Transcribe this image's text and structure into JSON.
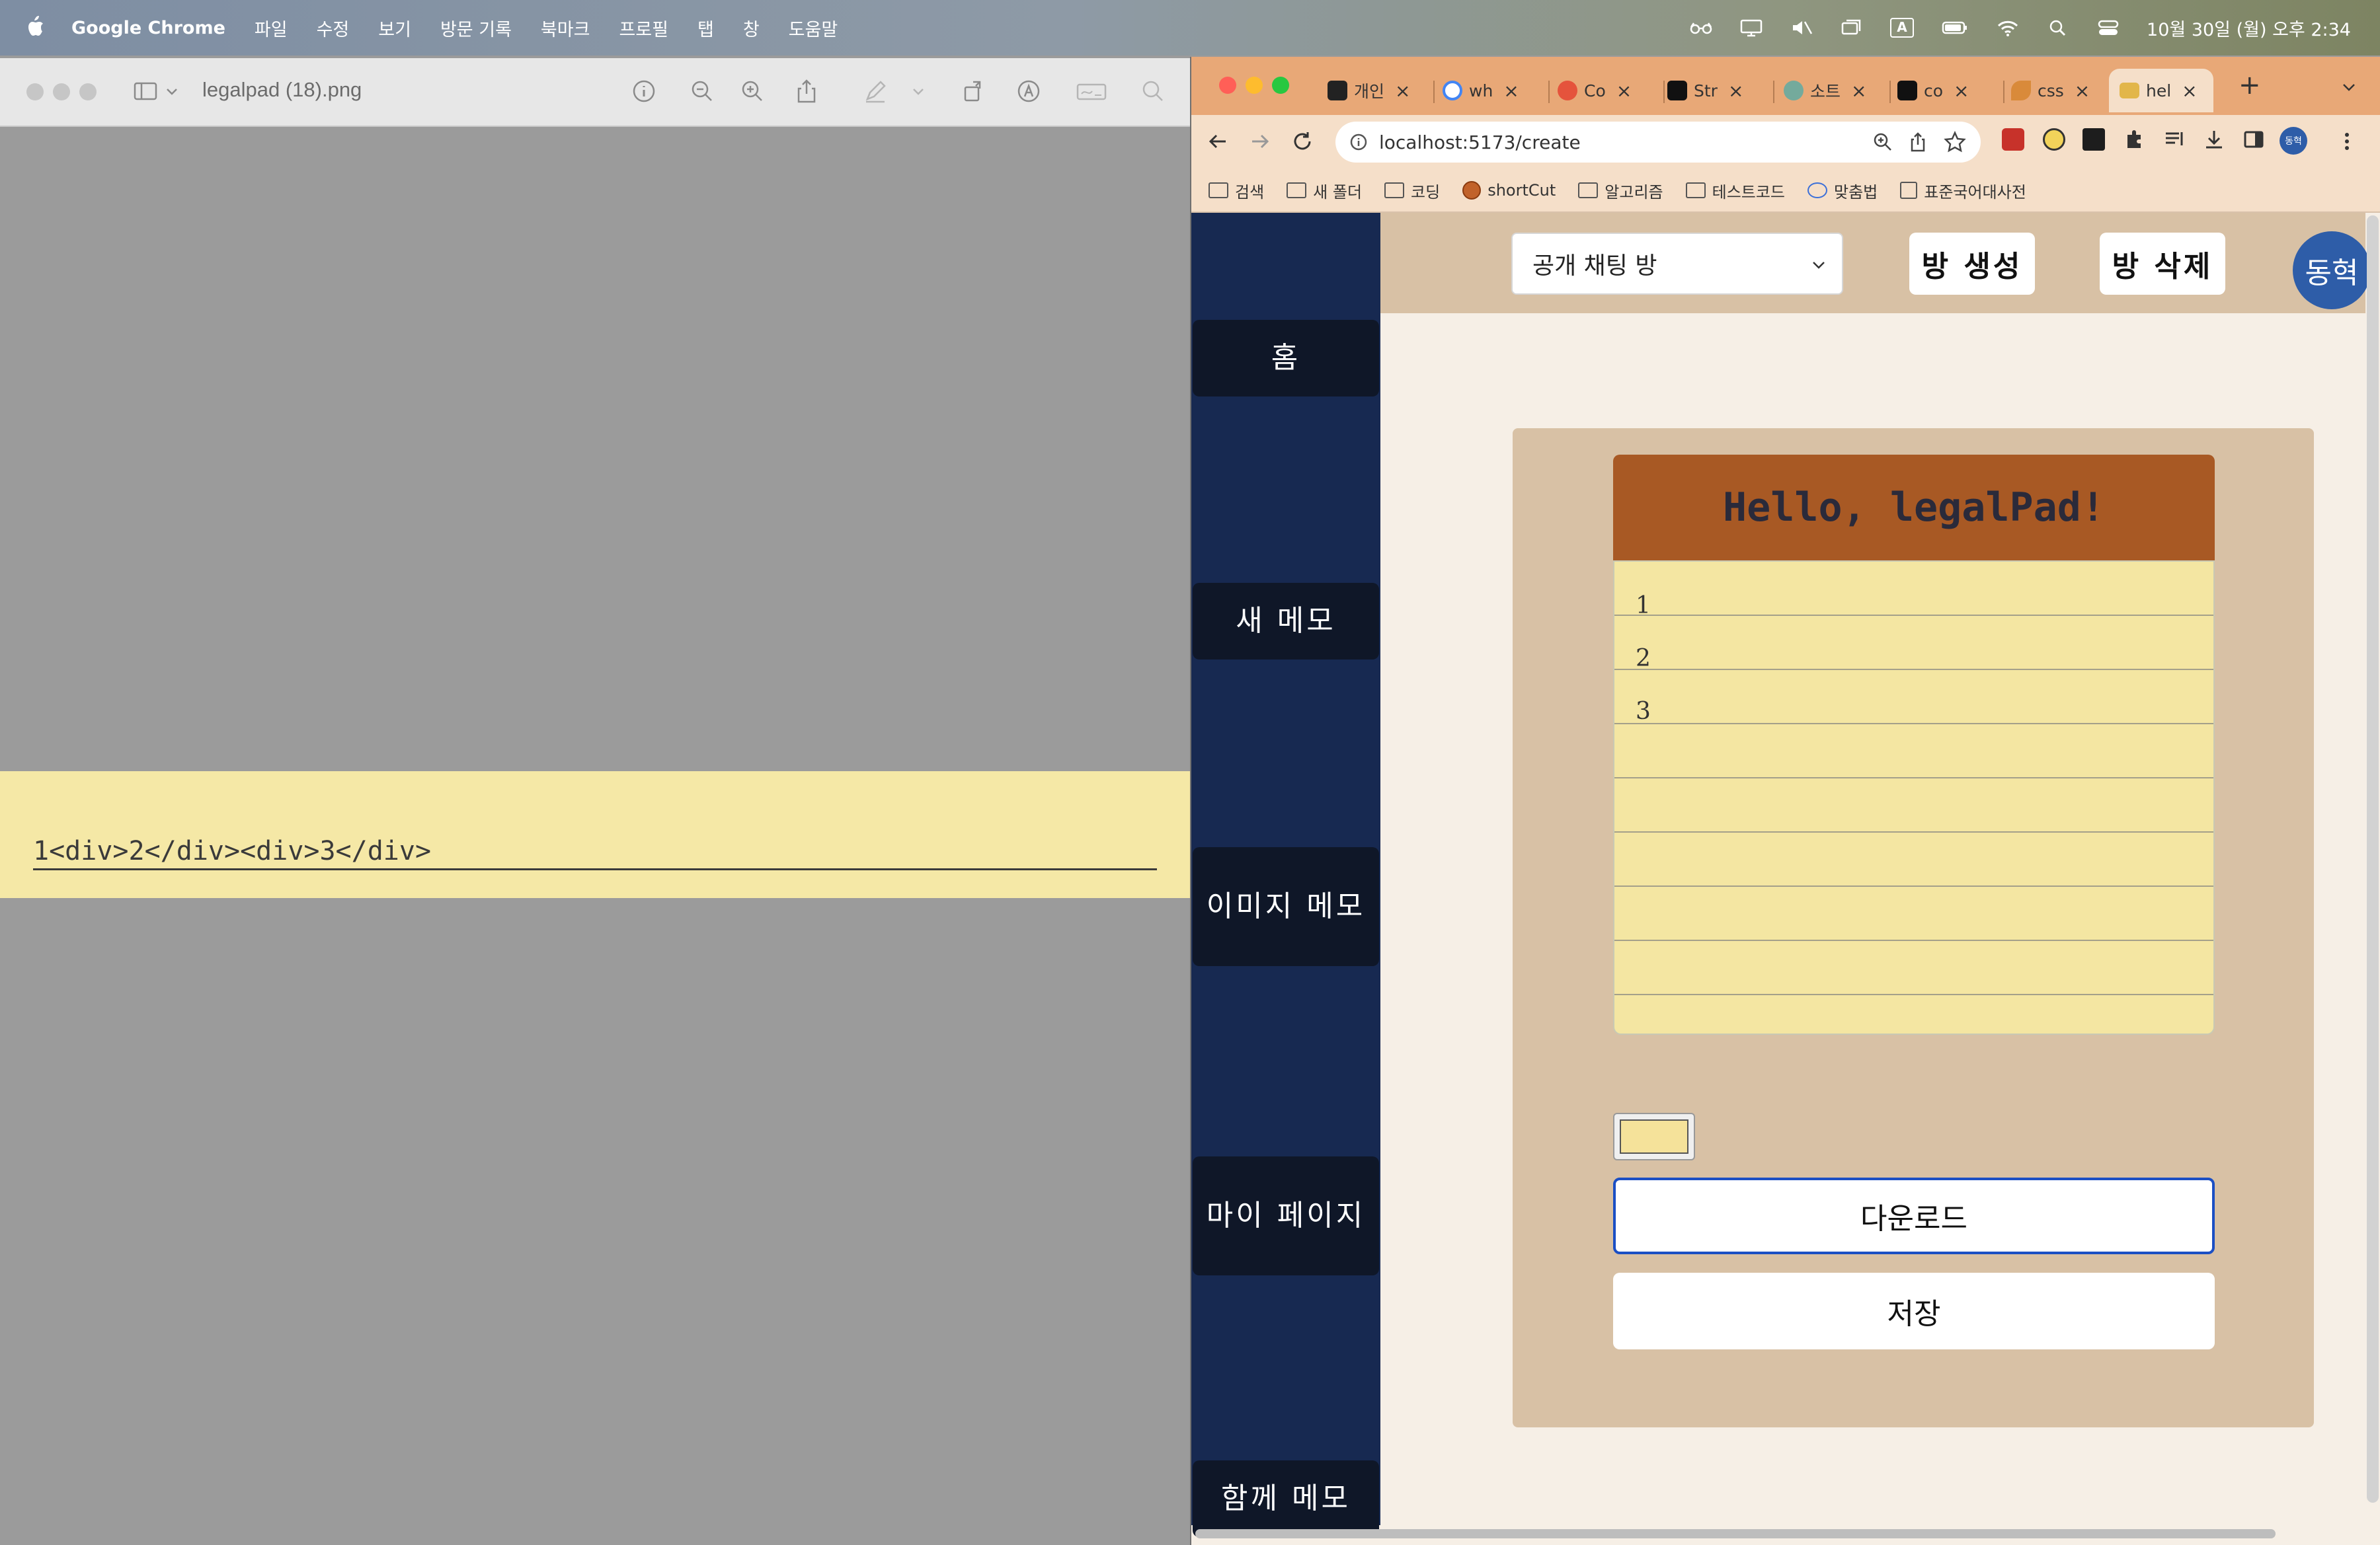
{
  "menubar": {
    "app_name": "Google Chrome",
    "items": [
      "파일",
      "수정",
      "보기",
      "방문 기록",
      "북마크",
      "프로필",
      "탭",
      "창",
      "도움말"
    ],
    "icons": [
      "glasses-icon",
      "display-icon",
      "mute-icon",
      "windows-icon",
      "input-icon",
      "battery-icon",
      "wifi-icon",
      "search-icon",
      "control-center-icon"
    ],
    "input_indicator": "A",
    "datetime": "10월 30일 (월) 오후 2:34"
  },
  "preview": {
    "file_name": "legalpad (18).png",
    "content_text": "1<div>2</div><div>3</div>"
  },
  "chrome": {
    "tabs": [
      {
        "label": "개인",
        "favicon": "notion-icon",
        "color": "#222222"
      },
      {
        "label": "wh",
        "favicon": "google-icon",
        "color": "#4285f4"
      },
      {
        "label": "Co",
        "favicon": "red-icon",
        "color": "#e5533c"
      },
      {
        "label": "Str",
        "favicon": "m-icon",
        "color": "#111111"
      },
      {
        "label": "소트",
        "favicon": "openai-icon",
        "color": "#74aa9c"
      },
      {
        "label": "co",
        "favicon": "m-icon",
        "color": "#111111"
      },
      {
        "label": "css",
        "favicon": "leaf-icon",
        "color": "#d98a3a"
      },
      {
        "label": "hel",
        "favicon": "legalpad-icon",
        "color": "#e2b64a",
        "active": true
      }
    ],
    "new_tab": "+",
    "url": "localhost:5173/create",
    "profile_badge": "동혁",
    "bookmarks": [
      "검색",
      "새 폴더",
      "코딩",
      "shortCut",
      "알고리즘",
      "테스트코드",
      "맞춤법",
      "표준국어대사전"
    ]
  },
  "app": {
    "sidebar": [
      "홈",
      "새 메모",
      "이미지 메모",
      "마이 페이지",
      "함께 메모"
    ],
    "room_select": {
      "selected": "공개 채팅 방"
    },
    "create_room": "방 생성",
    "delete_room": "방 삭제",
    "avatar": "동혁",
    "memo_title": "Hello, legalPad!",
    "memo_lines": [
      "1",
      "2",
      "3"
    ],
    "download": "다운로드",
    "save": "저장",
    "colors": {
      "sidebar": "#172951",
      "memo_header": "#a85924",
      "memo_paper": "#f4e6a2",
      "card": "#d8c1a5",
      "page": "#f6efe6",
      "avatar": "#2e5da8"
    }
  }
}
